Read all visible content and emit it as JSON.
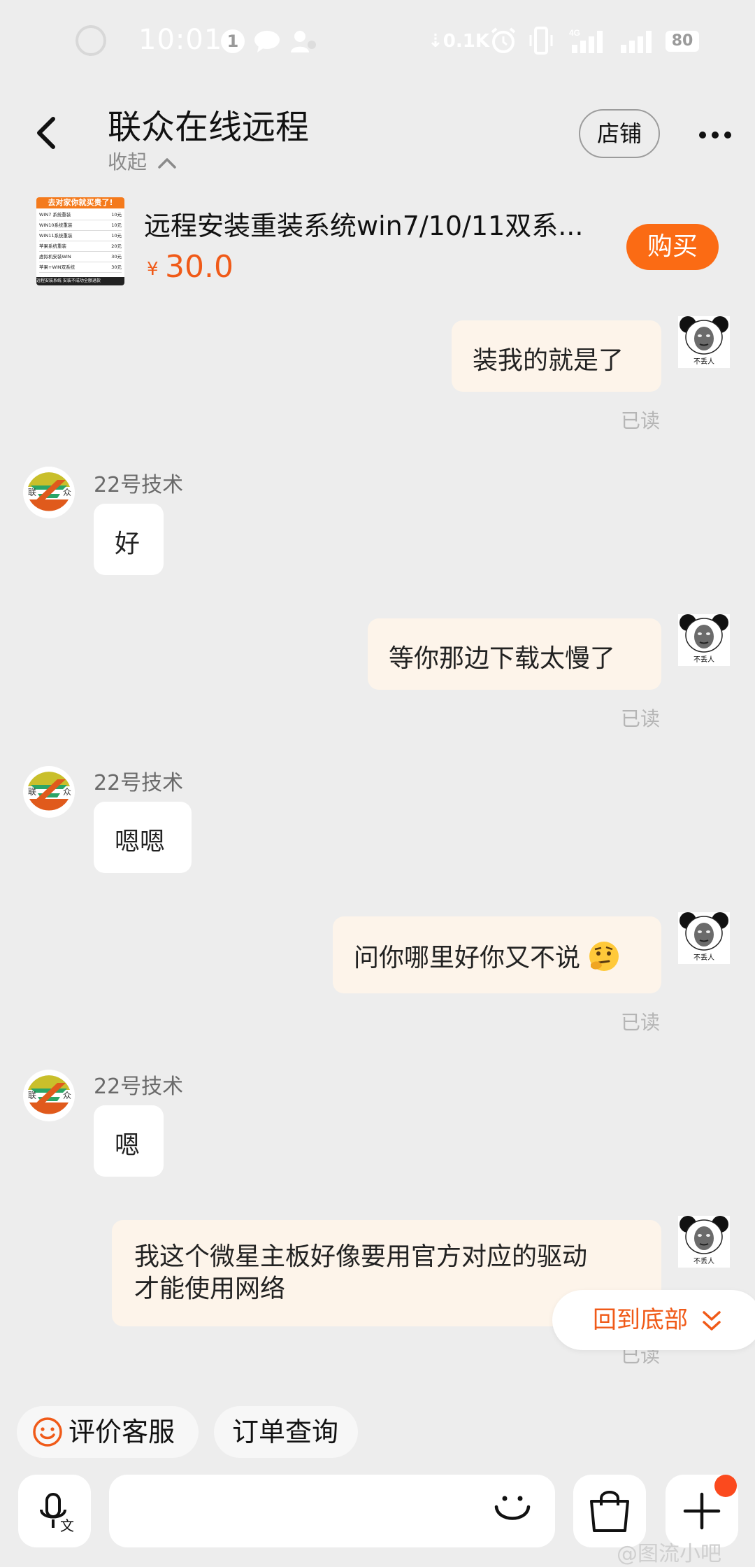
{
  "status_bar": {
    "time": "10:01",
    "notification_count": "1",
    "net_speed": "0.1K",
    "battery": "80",
    "network": "4G"
  },
  "header": {
    "title": "联众在线远程",
    "collapse_label": "收起",
    "store_button": "店铺"
  },
  "product": {
    "title": "远程安装重装系统win7/10/11双系...",
    "price_symbol": "¥",
    "price": "30.0",
    "buy_button": "购买",
    "thumb_banner": "去对家你就买贵了!",
    "thumb_footer": "远程安装系统  安装不成功全额退款",
    "thumb_rows": [
      {
        "name": "WIN7 系统重装",
        "price": "10元"
      },
      {
        "name": "WIN10系统重装",
        "price": "10元"
      },
      {
        "name": "WIN11系统重装",
        "price": "10元"
      },
      {
        "name": "苹果系统重装",
        "price": "20元"
      },
      {
        "name": "虚拟机安装WIN",
        "price": "30元"
      },
      {
        "name": "苹果+WIN双系统",
        "price": "30元"
      }
    ]
  },
  "user_avatar_caption": "不丢人",
  "shop_logo_text": {
    "left": "联",
    "right": "众"
  },
  "messages": [
    {
      "side": "out",
      "text": "装我的就是了",
      "status": "已读"
    },
    {
      "side": "in",
      "sender": "22号技术",
      "text": "好"
    },
    {
      "side": "out",
      "text": "等你那边下载太慢了",
      "status": "已读"
    },
    {
      "side": "in",
      "sender": "22号技术",
      "text": "嗯嗯"
    },
    {
      "side": "out",
      "text": "问你哪里好你又不说",
      "status": "已读"
    },
    {
      "side": "in",
      "sender": "22号技术",
      "text": "嗯"
    },
    {
      "side": "out",
      "text_line1": "我这个微星主板好像要用官方对应的驱动",
      "text_line2": "才能使用网络",
      "status": "已读"
    }
  ],
  "scroll_to_bottom": "回到底部",
  "quick_actions": {
    "rate_service": "评价客服",
    "order_query": "订单查询"
  },
  "input_bar": {
    "placeholder": "",
    "voice_sub": "文"
  },
  "watermark": "@图流小吧",
  "colors": {
    "accent": "#fb6b14",
    "price": "#f05a18",
    "background": "#ededed",
    "outgoing_bubble": "#fdf4ea"
  }
}
